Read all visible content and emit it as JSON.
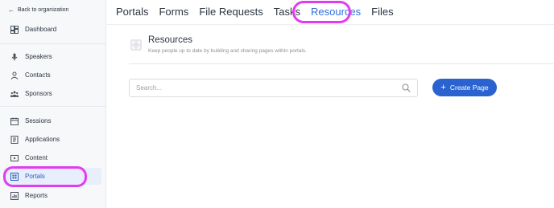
{
  "sidebar": {
    "back_label": "Back to organization",
    "items": [
      {
        "label": "Dashboard",
        "icon": "dashboard-icon"
      },
      {
        "label": "Speakers",
        "icon": "microphone-icon"
      },
      {
        "label": "Contacts",
        "icon": "person-icon"
      },
      {
        "label": "Sponsors",
        "icon": "people-group-icon"
      },
      {
        "label": "Sessions",
        "icon": "calendar-icon"
      },
      {
        "label": "Applications",
        "icon": "document-list-icon"
      },
      {
        "label": "Content",
        "icon": "play-video-icon"
      },
      {
        "label": "Portals",
        "icon": "portal-grid-icon",
        "active": true
      },
      {
        "label": "Reports",
        "icon": "bar-chart-icon"
      }
    ]
  },
  "tabs": [
    {
      "label": "Portals"
    },
    {
      "label": "Forms"
    },
    {
      "label": "File Requests"
    },
    {
      "label": "Tasks"
    },
    {
      "label": "Resources",
      "active": true
    },
    {
      "label": "Files"
    }
  ],
  "section": {
    "title": "Resources",
    "subtitle": "Keep people up to date by building and sharing pages within portals."
  },
  "search": {
    "placeholder": "Search...",
    "value": ""
  },
  "create_button": {
    "label": "Create Page"
  },
  "colors": {
    "accent": "#2a63cf",
    "active_tab": "#2f6fde",
    "highlight": "#e13cf0"
  }
}
